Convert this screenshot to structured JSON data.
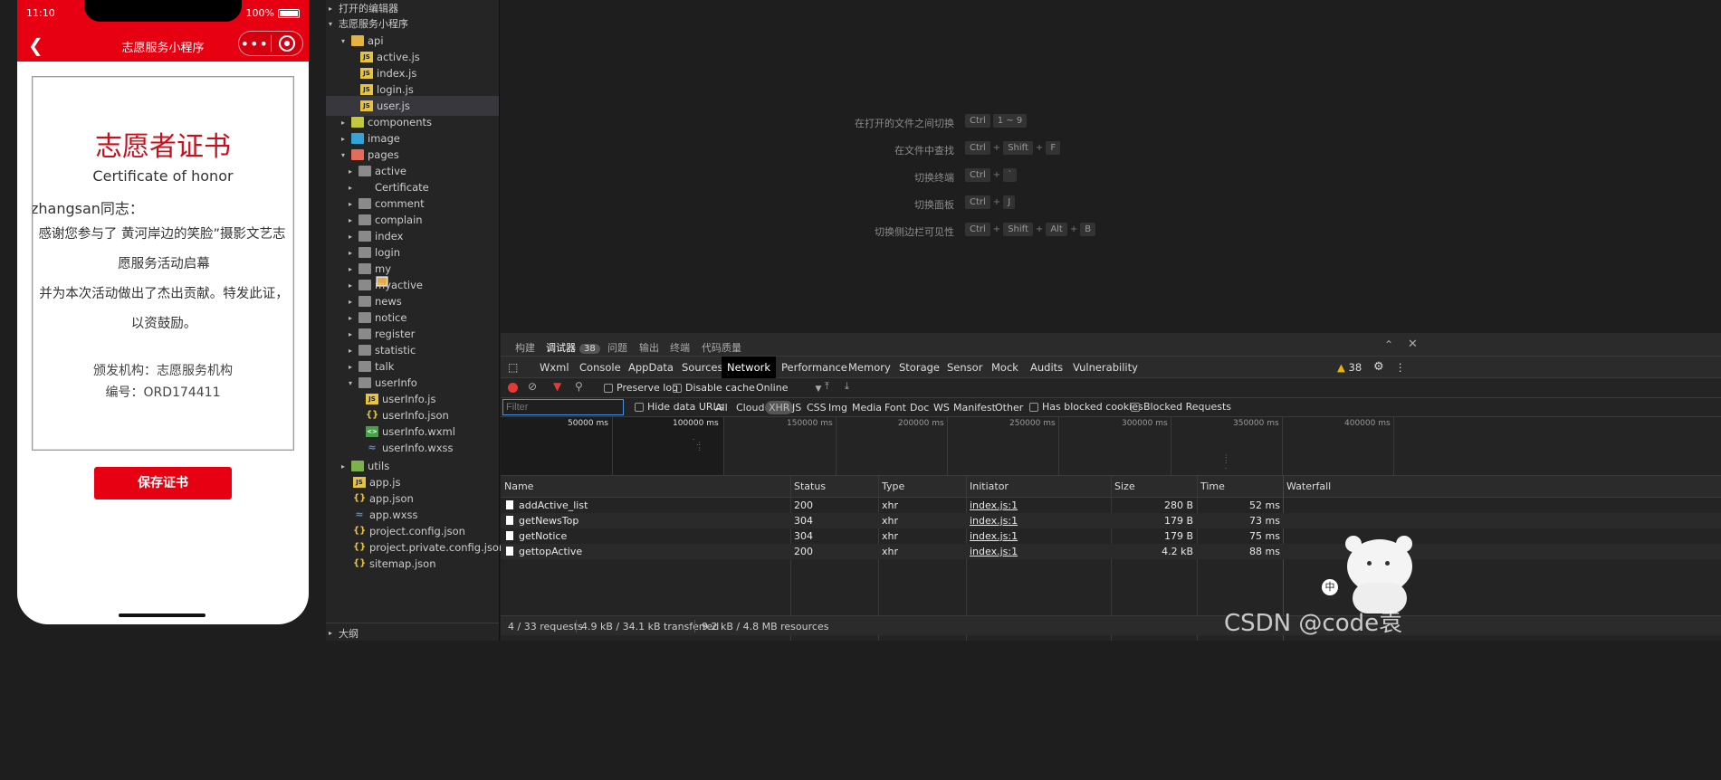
{
  "phone": {
    "time": "11:10",
    "battery": "100%",
    "nav_title": "志愿服务小程序",
    "more_icon": "•••",
    "certificate": {
      "title": "志愿者证书",
      "subtitle": "Certificate of honor",
      "greeting": "zhangsan同志：",
      "body_line1": "感谢您参与了 黄河岸边的笑脸”摄影文艺志",
      "body_line2": "愿服务活动启幕",
      "body_line3": "并为本次活动做出了杰出贡献。特发此证，",
      "body_line4": "以资鼓励。",
      "issuer": "颁发机构：志愿服务机构",
      "number": "编号：ORD174411"
    },
    "save_button": "保存证书",
    "accent_color": "#e60012"
  },
  "tree": {
    "open_editors": "打开的编辑器",
    "project": "志愿服务小程序",
    "api": "api",
    "api_files": [
      "active.js",
      "index.js",
      "login.js",
      "user.js"
    ],
    "components": "components",
    "image": "image",
    "pages": "pages",
    "page_dirs": [
      "active",
      "Certificate",
      "comment",
      "complain",
      "index",
      "login",
      "my",
      "myactive",
      "news",
      "notice",
      "register",
      "statistic",
      "talk"
    ],
    "userinfo": "userInfo",
    "userinfo_files": [
      "userInfo.js",
      "userInfo.json",
      "userInfo.wxml",
      "userInfo.wxss"
    ],
    "utils": "utils",
    "root_files": [
      "app.js",
      "app.json",
      "app.wxss",
      "project.config.json",
      "project.private.config.json",
      "sitemap.json"
    ],
    "outline": "大纲"
  },
  "editor": {
    "shortcuts": [
      {
        "label": "在打开的文件之间切换",
        "keys": [
          "Ctrl",
          "1 ~ 9"
        ]
      },
      {
        "label": "在文件中查找",
        "keys": [
          "Ctrl",
          "+",
          "Shift",
          "+",
          "F"
        ]
      },
      {
        "label": "切换终端",
        "keys": [
          "Ctrl",
          "+",
          "`"
        ]
      },
      {
        "label": "切换面板",
        "keys": [
          "Ctrl",
          "+",
          "J"
        ]
      },
      {
        "label": "切换侧边栏可见性",
        "keys": [
          "Ctrl",
          "+",
          "Shift",
          "+",
          "Alt",
          "+",
          "B"
        ]
      }
    ]
  },
  "devtools": {
    "top_tabs": [
      "构建",
      "调试器",
      "问题",
      "输出",
      "终端",
      "代码质量"
    ],
    "debugger_badge": "38",
    "panel_tabs": [
      "Wxml",
      "Console",
      "AppData",
      "Sources",
      "Network",
      "Performance",
      "Memory",
      "Storage",
      "Sensor",
      "Mock",
      "Audits",
      "Vulnerability"
    ],
    "warning_count": "38",
    "preserve_log": "Preserve log",
    "disable_cache": "Disable cache",
    "throttle": "Online",
    "filter_placeholder": "Filter",
    "hide_data_urls": "Hide data URLs",
    "type_filters": [
      "All",
      "Cloud",
      "XHR",
      "JS",
      "CSS",
      "Img",
      "Media",
      "Font",
      "Doc",
      "WS",
      "Manifest",
      "Other"
    ],
    "has_blocked_cookies": "Has blocked cookies",
    "blocked_requests": "Blocked Requests",
    "overview_ticks": [
      "50000 ms",
      "100000 ms",
      "150000 ms",
      "200000 ms",
      "250000 ms",
      "300000 ms",
      "350000 ms",
      "400000 ms"
    ],
    "columns": [
      "Name",
      "Status",
      "Type",
      "Initiator",
      "Size",
      "Time",
      "Waterfall"
    ],
    "rows": [
      {
        "name": "addActive_list",
        "status": "200",
        "type": "xhr",
        "initiator": "index.js:1",
        "size": "280 B",
        "time": "52 ms"
      },
      {
        "name": "getNewsTop",
        "status": "304",
        "type": "xhr",
        "initiator": "index.js:1",
        "size": "179 B",
        "time": "73 ms"
      },
      {
        "name": "getNotice",
        "status": "304",
        "type": "xhr",
        "initiator": "index.js:1",
        "size": "179 B",
        "time": "75 ms"
      },
      {
        "name": "gettopActive",
        "status": "200",
        "type": "xhr",
        "initiator": "index.js:1",
        "size": "4.2 kB",
        "time": "88 ms"
      }
    ],
    "status_requests": "4 / 33 requests",
    "status_transferred": "4.9 kB / 34.1 kB transferred",
    "status_resources": "9.2 kB / 4.8 MB resources"
  },
  "watermark": "CSDN @code袁"
}
